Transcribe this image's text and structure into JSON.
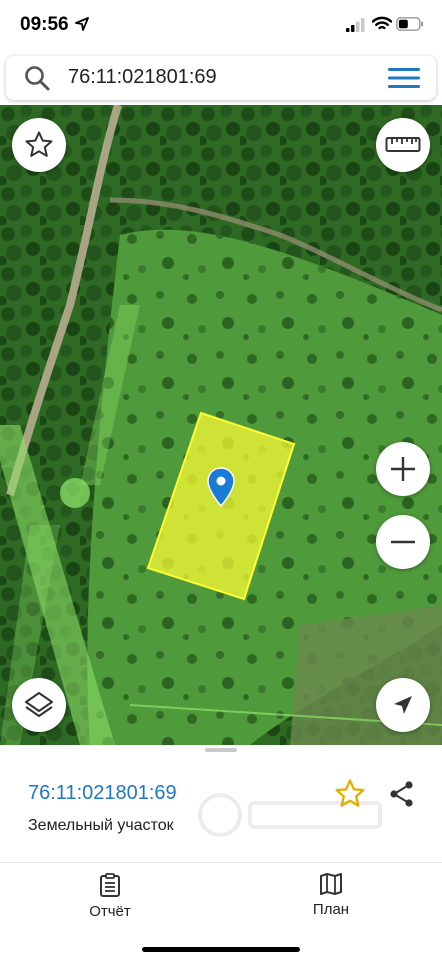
{
  "status_bar": {
    "time": "09:56"
  },
  "search": {
    "query": "76:11:021801:69"
  },
  "map": {
    "parcel_color": "#ffff33",
    "buffer_color": "#8fe36a",
    "marker_color": "#1a7bd6",
    "controls": {
      "favorite": "star-outline-icon",
      "ruler": "ruler-icon",
      "zoom_in": "plus-icon",
      "zoom_out": "minus-icon",
      "layers": "layers-icon",
      "locate": "navigation-arrow-icon"
    }
  },
  "sheet": {
    "cadastral_number": "76:11:021801:69",
    "object_type": "Земельный участок",
    "favorite_color": "#e0b000"
  },
  "tabs": [
    {
      "label": "Отчёт",
      "icon": "clipboard-icon"
    },
    {
      "label": "План",
      "icon": "map-icon"
    }
  ]
}
